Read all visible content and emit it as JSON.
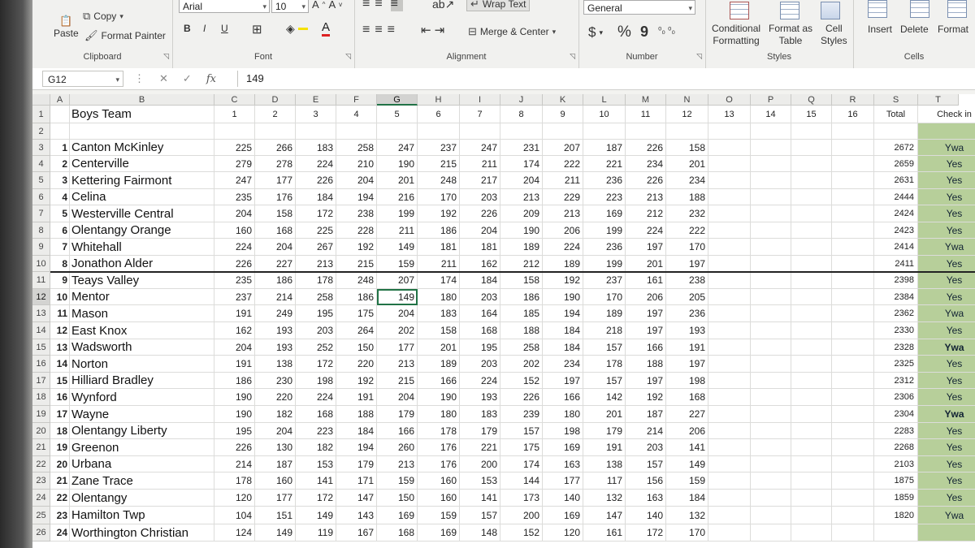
{
  "ribbon": {
    "clipboard": {
      "paste": "Paste",
      "copy": "Copy",
      "format_painter": "Format Painter",
      "label": "Clipboard"
    },
    "font": {
      "name": "Arial",
      "size": "10",
      "bold": "B",
      "italic": "I",
      "underline": "U",
      "label": "Font"
    },
    "alignment": {
      "wrap_text": "Wrap Text",
      "merge_center": "Merge & Center",
      "label": "Alignment"
    },
    "number": {
      "format": "General",
      "currency": "$",
      "percent": "%",
      "comma": "9",
      "label": "Number"
    },
    "styles": {
      "conditional": "Conditional",
      "formatting": "Formatting",
      "format_as": "Format as",
      "table": "Table",
      "cell": "Cell",
      "cell_styles": "Styles",
      "label": "Styles"
    },
    "cells": {
      "insert": "Insert",
      "delete": "Delete",
      "format": "Format",
      "label": "Cells"
    }
  },
  "formula_bar": {
    "name_box": "G12",
    "value": "149",
    "fx": "fx"
  },
  "columns": [
    "A",
    "B",
    "C",
    "D",
    "E",
    "F",
    "G",
    "H",
    "I",
    "J",
    "K",
    "L",
    "M",
    "N",
    "O",
    "P",
    "Q",
    "R",
    "S",
    "T"
  ],
  "header_row": {
    "title": "Boys Team",
    "game_numbers": [
      "1",
      "2",
      "3",
      "4",
      "5",
      "6",
      "7",
      "8",
      "9",
      "10",
      "11",
      "12",
      "13",
      "14",
      "15",
      "16"
    ],
    "total": "Total",
    "check": "Check in"
  },
  "teams": [
    {
      "idx": "1",
      "name": "Canton McKinley",
      "scores": [
        "225",
        "266",
        "183",
        "258",
        "247",
        "237",
        "247",
        "231",
        "207",
        "187",
        "226",
        "158"
      ],
      "total": "2672",
      "check": "Ywa"
    },
    {
      "idx": "2",
      "name": "Centerville",
      "scores": [
        "279",
        "278",
        "224",
        "210",
        "190",
        "215",
        "211",
        "174",
        "222",
        "221",
        "234",
        "201"
      ],
      "total": "2659",
      "check": "Yes"
    },
    {
      "idx": "3",
      "name": "Kettering Fairmont",
      "scores": [
        "247",
        "177",
        "226",
        "204",
        "201",
        "248",
        "217",
        "204",
        "211",
        "236",
        "226",
        "234"
      ],
      "total": "2631",
      "check": "Yes"
    },
    {
      "idx": "4",
      "name": "Celina",
      "scores": [
        "235",
        "176",
        "184",
        "194",
        "216",
        "170",
        "203",
        "213",
        "229",
        "223",
        "213",
        "188"
      ],
      "total": "2444",
      "check": "Yes"
    },
    {
      "idx": "5",
      "name": "Westerville Central",
      "scores": [
        "204",
        "158",
        "172",
        "238",
        "199",
        "192",
        "226",
        "209",
        "213",
        "169",
        "212",
        "232"
      ],
      "total": "2424",
      "check": "Yes"
    },
    {
      "idx": "6",
      "name": "Olentangy Orange",
      "scores": [
        "160",
        "168",
        "225",
        "228",
        "211",
        "186",
        "204",
        "190",
        "206",
        "199",
        "224",
        "222"
      ],
      "total": "2423",
      "check": "Yes"
    },
    {
      "idx": "7",
      "name": "Whitehall",
      "scores": [
        "224",
        "204",
        "267",
        "192",
        "149",
        "181",
        "181",
        "189",
        "224",
        "236",
        "197",
        "170"
      ],
      "total": "2414",
      "check": "Ywa"
    },
    {
      "idx": "8",
      "name": "Jonathon Alder",
      "scores": [
        "226",
        "227",
        "213",
        "215",
        "159",
        "211",
        "162",
        "212",
        "189",
        "199",
        "201",
        "197"
      ],
      "total": "2411",
      "check": "Yes"
    },
    {
      "idx": "9",
      "name": "Teays Valley",
      "scores": [
        "235",
        "186",
        "178",
        "248",
        "207",
        "174",
        "184",
        "158",
        "192",
        "237",
        "161",
        "238"
      ],
      "total": "2398",
      "check": "Yes"
    },
    {
      "idx": "10",
      "name": "Mentor",
      "scores": [
        "237",
        "214",
        "258",
        "186",
        "149",
        "180",
        "203",
        "186",
        "190",
        "170",
        "206",
        "205"
      ],
      "total": "2384",
      "check": "Yes"
    },
    {
      "idx": "11",
      "name": "Mason",
      "scores": [
        "191",
        "249",
        "195",
        "175",
        "204",
        "183",
        "164",
        "185",
        "194",
        "189",
        "197",
        "236"
      ],
      "total": "2362",
      "check": "Ywa"
    },
    {
      "idx": "12",
      "name": "East Knox",
      "scores": [
        "162",
        "193",
        "203",
        "264",
        "202",
        "158",
        "168",
        "188",
        "184",
        "218",
        "197",
        "193"
      ],
      "total": "2330",
      "check": "Yes"
    },
    {
      "idx": "13",
      "name": "Wadsworth",
      "scores": [
        "204",
        "193",
        "252",
        "150",
        "177",
        "201",
        "195",
        "258",
        "184",
        "157",
        "166",
        "191"
      ],
      "total": "2328",
      "check": "Ywa"
    },
    {
      "idx": "14",
      "name": "Norton",
      "scores": [
        "191",
        "138",
        "172",
        "220",
        "213",
        "189",
        "203",
        "202",
        "234",
        "178",
        "188",
        "197"
      ],
      "total": "2325",
      "check": "Yes"
    },
    {
      "idx": "15",
      "name": "Hilliard Bradley",
      "scores": [
        "186",
        "230",
        "198",
        "192",
        "215",
        "166",
        "224",
        "152",
        "197",
        "157",
        "197",
        "198"
      ],
      "total": "2312",
      "check": "Yes"
    },
    {
      "idx": "16",
      "name": "Wynford",
      "scores": [
        "190",
        "220",
        "224",
        "191",
        "204",
        "190",
        "193",
        "226",
        "166",
        "142",
        "192",
        "168"
      ],
      "total": "2306",
      "check": "Yes"
    },
    {
      "idx": "17",
      "name": "Wayne",
      "scores": [
        "190",
        "182",
        "168",
        "188",
        "179",
        "180",
        "183",
        "239",
        "180",
        "201",
        "187",
        "227"
      ],
      "total": "2304",
      "check": "Ywa"
    },
    {
      "idx": "18",
      "name": "Olentangy Liberty",
      "scores": [
        "195",
        "204",
        "223",
        "184",
        "166",
        "178",
        "179",
        "157",
        "198",
        "179",
        "214",
        "206"
      ],
      "total": "2283",
      "check": "Yes"
    },
    {
      "idx": "19",
      "name": "Greenon",
      "scores": [
        "226",
        "130",
        "182",
        "194",
        "260",
        "176",
        "221",
        "175",
        "169",
        "191",
        "203",
        "141"
      ],
      "total": "2268",
      "check": "Yes"
    },
    {
      "idx": "20",
      "name": "Urbana",
      "scores": [
        "214",
        "187",
        "153",
        "179",
        "213",
        "176",
        "200",
        "174",
        "163",
        "138",
        "157",
        "149"
      ],
      "total": "2103",
      "check": "Yes"
    },
    {
      "idx": "21",
      "name": "Zane Trace",
      "scores": [
        "178",
        "160",
        "141",
        "171",
        "159",
        "160",
        "153",
        "144",
        "177",
        "117",
        "156",
        "159"
      ],
      "total": "1875",
      "check": "Yes"
    },
    {
      "idx": "22",
      "name": "Olentangy",
      "scores": [
        "120",
        "177",
        "172",
        "147",
        "150",
        "160",
        "141",
        "173",
        "140",
        "132",
        "163",
        "184"
      ],
      "total": "1859",
      "check": "Yes"
    },
    {
      "idx": "23",
      "name": "Hamilton Twp",
      "scores": [
        "104",
        "151",
        "149",
        "143",
        "169",
        "159",
        "157",
        "200",
        "169",
        "147",
        "140",
        "132"
      ],
      "total": "1820",
      "check": "Ywa"
    },
    {
      "idx": "24",
      "name": "Worthington Christian",
      "scores": [
        "124",
        "149",
        "119",
        "167",
        "168",
        "169",
        "148",
        "152",
        "120",
        "161",
        "172",
        "170"
      ],
      "total": "",
      "check": ""
    }
  ]
}
